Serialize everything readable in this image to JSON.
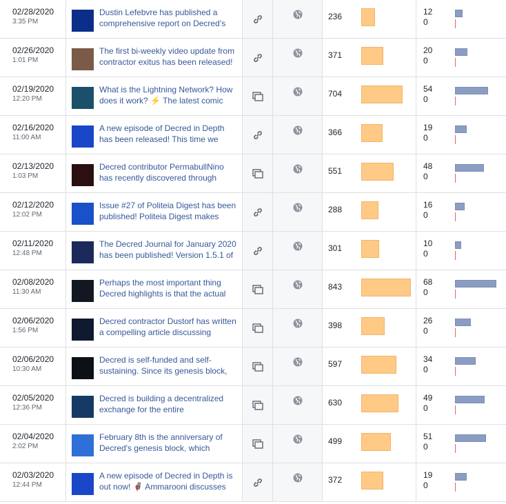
{
  "posts": [
    {
      "date": "02/28/2020",
      "time": "3:35 PM",
      "text": "Dustin Lefebvre has published a comprehensive report on Decred’s",
      "type_icon": "link-icon",
      "reach": "236",
      "reach_value": 236,
      "eng_top": "12",
      "eng_bottom": "0",
      "eng_value": 12,
      "thumb": "#0b2e8a"
    },
    {
      "date": "02/26/2020",
      "time": "1:01 PM",
      "text": "The first bi-weekly video update from contractor exitus has been released!",
      "type_icon": "link-icon",
      "reach": "371",
      "reach_value": 371,
      "eng_top": "20",
      "eng_bottom": "0",
      "eng_value": 20,
      "thumb": "#7a5a48"
    },
    {
      "date": "02/19/2020",
      "time": "12:20 PM",
      "text": "What is the Lightning Network? How does it work? ⚡ The latest comic",
      "type_icon": "album-icon",
      "reach": "704",
      "reach_value": 704,
      "eng_top": "54",
      "eng_bottom": "0",
      "eng_value": 54,
      "thumb": "#1c4f6a"
    },
    {
      "date": "02/16/2020",
      "time": "11:00 AM",
      "text": "A new episode of Decred in Depth has been released! This time we",
      "type_icon": "link-icon",
      "reach": "366",
      "reach_value": 366,
      "eng_top": "19",
      "eng_bottom": "0",
      "eng_value": 19,
      "thumb": "#1a46c8"
    },
    {
      "date": "02/13/2020",
      "time": "1:03 PM",
      "text": "Decred contributor PermabullNino has recently discovered through",
      "type_icon": "album-icon",
      "reach": "551",
      "reach_value": 551,
      "eng_top": "48",
      "eng_bottom": "0",
      "eng_value": 48,
      "thumb": "#2a1010"
    },
    {
      "date": "02/12/2020",
      "time": "12:02 PM",
      "text": "Issue #27 of Politeia Digest has been published! Politeia Digest makes",
      "type_icon": "link-icon",
      "reach": "288",
      "reach_value": 288,
      "eng_top": "16",
      "eng_bottom": "0",
      "eng_value": 16,
      "thumb": "#1a50c8"
    },
    {
      "date": "02/11/2020",
      "time": "12:48 PM",
      "text": "The Decred Journal for January 2020 has been published! Version 1.5.1 of",
      "type_icon": "link-icon",
      "reach": "301",
      "reach_value": 301,
      "eng_top": "10",
      "eng_bottom": "0",
      "eng_value": 10,
      "thumb": "#1b2a5a"
    },
    {
      "date": "02/08/2020",
      "time": "11:30 AM",
      "text": "Perhaps the most important thing Decred highlights is that the actual",
      "type_icon": "album-icon",
      "reach": "843",
      "reach_value": 843,
      "eng_top": "68",
      "eng_bottom": "0",
      "eng_value": 68,
      "thumb": "#111822"
    },
    {
      "date": "02/06/2020",
      "time": "1:56 PM",
      "text": "Decred contractor Dustorf has written a compelling article discussing",
      "type_icon": "album-icon",
      "reach": "398",
      "reach_value": 398,
      "eng_top": "26",
      "eng_bottom": "0",
      "eng_value": 26,
      "thumb": "#0f1930"
    },
    {
      "date": "02/06/2020",
      "time": "10:30 AM",
      "text": "Decred is self-funded and self-sustaining. Since its genesis block,",
      "type_icon": "album-icon",
      "reach": "597",
      "reach_value": 597,
      "eng_top": "34",
      "eng_bottom": "0",
      "eng_value": 34,
      "thumb": "#0c1118"
    },
    {
      "date": "02/05/2020",
      "time": "12:36 PM",
      "text": "Decred is building a decentralized exchange for the entire",
      "type_icon": "album-icon",
      "reach": "630",
      "reach_value": 630,
      "eng_top": "49",
      "eng_bottom": "0",
      "eng_value": 49,
      "thumb": "#163a66"
    },
    {
      "date": "02/04/2020",
      "time": "2:02 PM",
      "text": "February 8th is the anniversary of Decred's genesis block, which",
      "type_icon": "album-icon",
      "reach": "499",
      "reach_value": 499,
      "eng_top": "51",
      "eng_bottom": "0",
      "eng_value": 51,
      "thumb": "#2f6fd8"
    },
    {
      "date": "02/03/2020",
      "time": "12:44 PM",
      "text": "A new episode of Decred in Depth is out now! 🦸 Ammarooni discusses",
      "type_icon": "link-icon",
      "reach": "372",
      "reach_value": 372,
      "eng_top": "19",
      "eng_bottom": "0",
      "eng_value": 19,
      "thumb": "#1a46c8"
    }
  ],
  "colors": {
    "reach_bar": "#ffc986",
    "engagement_bar": "#8b9dc3",
    "link_text": "#365899"
  },
  "target_icon": "globe-icon"
}
